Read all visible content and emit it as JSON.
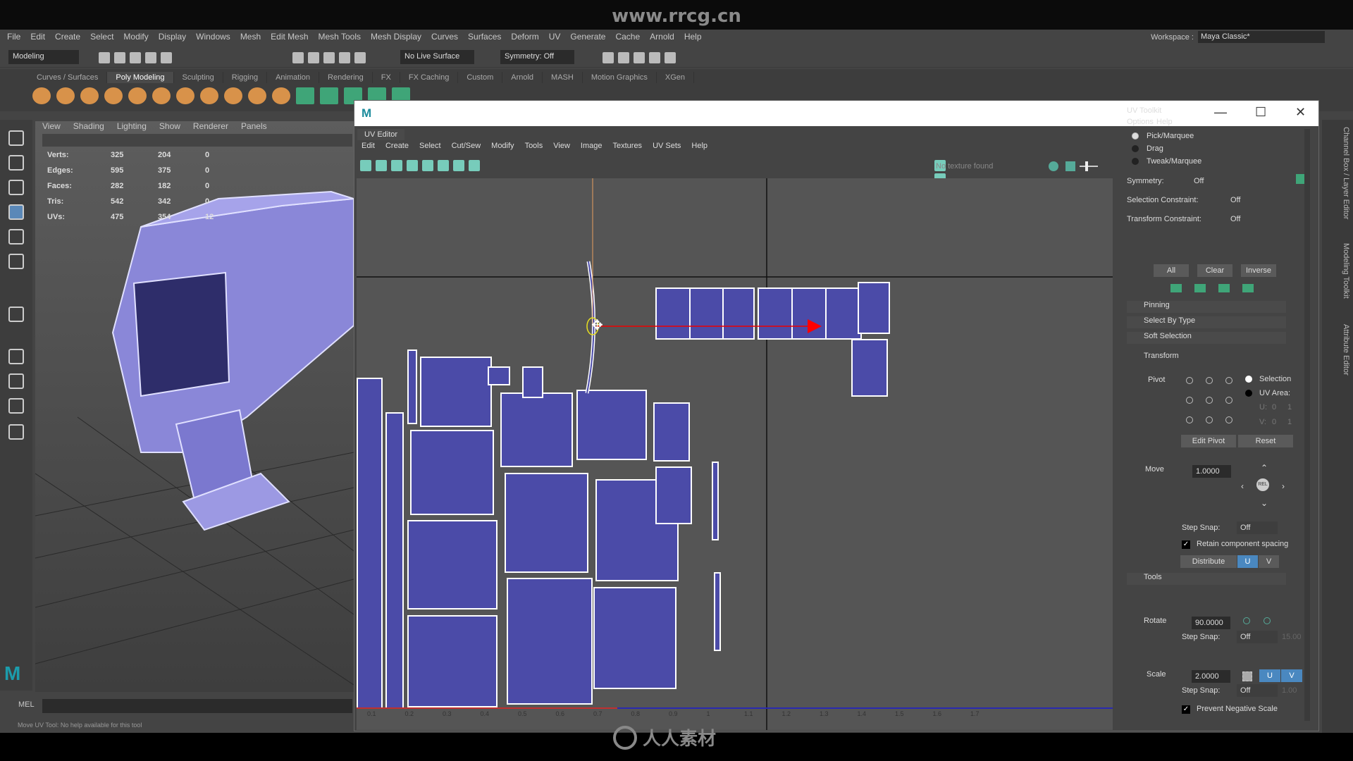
{
  "watermark": {
    "site": "www.rrcg.cn",
    "logo_text": "人人素材"
  },
  "menubar": {
    "items": [
      "File",
      "Edit",
      "Create",
      "Select",
      "Modify",
      "Display",
      "Windows",
      "Mesh",
      "Edit Mesh",
      "Mesh Tools",
      "Mesh Display",
      "Curves",
      "Surfaces",
      "Deform",
      "UV",
      "Generate",
      "Cache",
      "Arnold",
      "Help"
    ]
  },
  "workspace": {
    "label": "Workspace :",
    "value": "Maya Classic*"
  },
  "statusline": {
    "mode": "Modeling",
    "live_surface": "No Live Surface",
    "symmetry": "Symmetry: Off"
  },
  "shelf": {
    "tabs": [
      "Curves / Surfaces",
      "Poly Modeling",
      "Sculpting",
      "Rigging",
      "Animation",
      "Rendering",
      "FX",
      "FX Caching",
      "Custom",
      "Arnold",
      "MASH",
      "Motion Graphics",
      "XGen"
    ],
    "active": "Poly Modeling"
  },
  "viewport": {
    "menu": [
      "View",
      "Shading",
      "Lighting",
      "Show",
      "Renderer",
      "Panels"
    ],
    "hud": [
      {
        "label": "Verts:",
        "a": "325",
        "b": "204",
        "c": "0"
      },
      {
        "label": "Edges:",
        "a": "595",
        "b": "375",
        "c": "0"
      },
      {
        "label": "Faces:",
        "a": "282",
        "b": "182",
        "c": "0"
      },
      {
        "label": "Tris:",
        "a": "542",
        "b": "342",
        "c": "0"
      },
      {
        "label": "UVs:",
        "a": "475",
        "b": "354",
        "c": "12"
      }
    ]
  },
  "mel": {
    "label": "MEL",
    "help": "Move UV Tool: No help available for this tool"
  },
  "uv_editor": {
    "tab": "UV Editor",
    "menu": [
      "Edit",
      "Create",
      "Select",
      "Cut/Sew",
      "Modify",
      "Tools",
      "View",
      "Image",
      "Textures",
      "UV Sets",
      "Help"
    ],
    "no_texture": "No texture found",
    "axis_ticks": [
      "0.1",
      "0.2",
      "0.3",
      "0.4",
      "0.5",
      "0.6",
      "0.7",
      "0.8",
      "0.9",
      "1",
      "1.1",
      "1.2",
      "1.3",
      "1.4",
      "1.5",
      "1.6",
      "1.7"
    ],
    "shell_color": "#4b4ba8"
  },
  "toolkit": {
    "title": "UV Toolkit",
    "menu": [
      "Options",
      "Help"
    ],
    "modes": [
      "Pick/Marquee",
      "Drag",
      "Tweak/Marquee"
    ],
    "symmetry": {
      "label": "Symmetry:",
      "value": "Off"
    },
    "selection_constraint": {
      "label": "Selection Constraint:",
      "value": "Off"
    },
    "transform_constraint": {
      "label": "Transform Constraint:",
      "value": "Off"
    },
    "buttons": [
      "All",
      "Clear",
      "Inverse"
    ],
    "sections": [
      "Pinning",
      "Select By Type",
      "Soft Selection",
      "Transform",
      "Tools"
    ],
    "pivot": {
      "label": "Pivot",
      "selection": "Selection",
      "uv_area": "UV Area:",
      "u": "U:",
      "v": "V:",
      "u_vals": [
        "0",
        "1"
      ],
      "v_vals": [
        "0",
        "1"
      ],
      "edit": "Edit Pivot",
      "reset": "Reset"
    },
    "move": {
      "label": "Move",
      "value": "1.0000",
      "rel": "REL",
      "step_label": "Step Snap:",
      "step": "Off",
      "retain": "Retain component spacing",
      "distribute": "Distribute",
      "u": "U",
      "v": "V"
    },
    "rotate": {
      "label": "Rotate",
      "value": "90.0000",
      "step_label": "Step Snap:",
      "step": "Off",
      "step_val": "15.00"
    },
    "scale": {
      "label": "Scale",
      "value": "2.0000",
      "u": "U",
      "v": "V",
      "step_label": "Step Snap:",
      "step": "Off",
      "step_val": "1.00",
      "prevent": "Prevent Negative Scale"
    }
  },
  "right_tabs": [
    "Channel Box / Layer Editor",
    "Modeling Toolkit",
    "Attribute Editor"
  ]
}
